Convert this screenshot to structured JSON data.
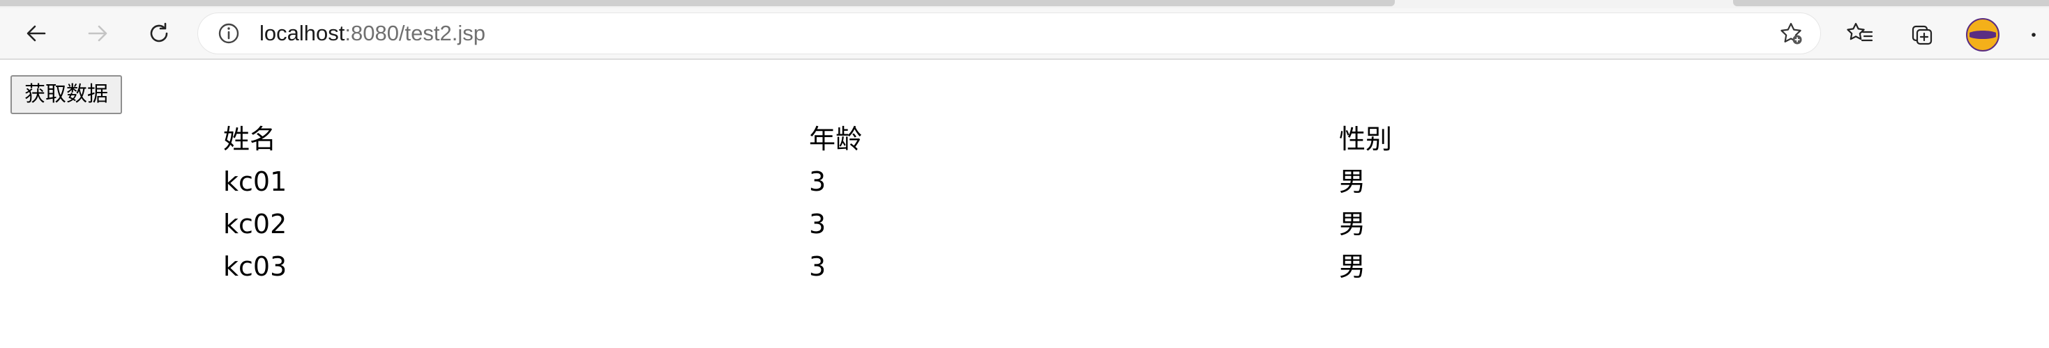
{
  "browser": {
    "url_host": "localhost",
    "url_rest": ":8080/test2.jsp",
    "icons": [
      "back-icon",
      "forward-icon",
      "refresh-icon",
      "info-icon",
      "add-favorite-icon",
      "favorites-icon",
      "collections-icon",
      "profile-avatar",
      "more-icon"
    ]
  },
  "page": {
    "fetch_button_label": "获取数据",
    "table": {
      "headers": [
        "姓名",
        "年龄",
        "性别"
      ],
      "rows": [
        [
          "kc01",
          "3",
          "男"
        ],
        [
          "kc02",
          "3",
          "男"
        ],
        [
          "kc03",
          "3",
          "男"
        ]
      ]
    }
  },
  "colors": {
    "toolbar_bg": "#f7f7f7",
    "page_bg": "#ffffff",
    "url_path": "#707070"
  }
}
